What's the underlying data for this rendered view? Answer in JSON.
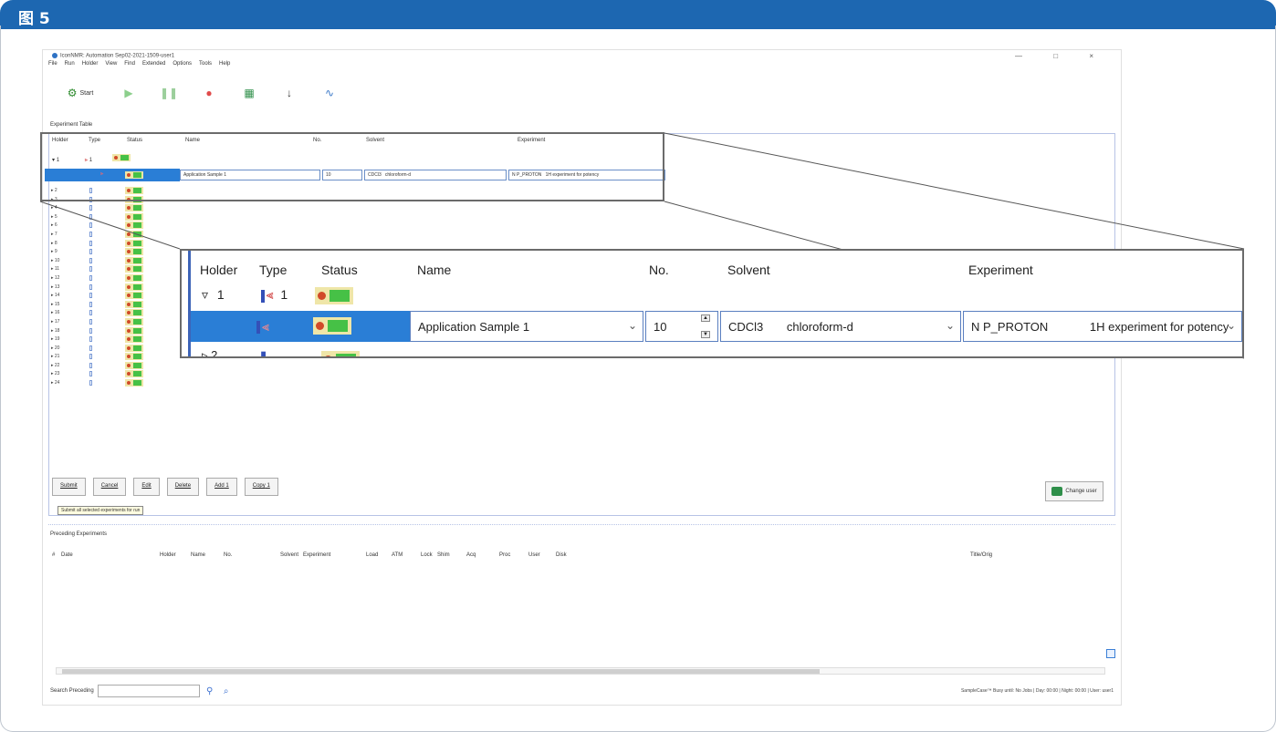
{
  "figure": {
    "label": "图 5"
  },
  "window": {
    "title": "IconNMR: Automation Sep02-2021-1509-user1",
    "controls": "— □ ×"
  },
  "menu": [
    "File",
    "Run",
    "Holder",
    "View",
    "Find",
    "Extended",
    "Options",
    "Tools",
    "Help"
  ],
  "toolbar": {
    "start_label": "Start"
  },
  "experiment_table": {
    "title": "Experiment Table",
    "columns": [
      "Holder",
      "Type",
      "Status",
      "Name",
      "No.",
      "Solvent",
      "Experiment"
    ],
    "holder1": {
      "holder": "1",
      "type_count": "1"
    },
    "selected": {
      "name": "Application Sample 1",
      "no": "10",
      "solvent_code": "CDCl3",
      "solvent_name": "chloroform-d",
      "experiment_code": "N P_PROTON",
      "experiment_desc": "1H experiment for potency"
    },
    "holders": [
      "2",
      "3",
      "4",
      "5",
      "6",
      "7",
      "8",
      "9",
      "10",
      "11",
      "12",
      "13",
      "14",
      "15",
      "16",
      "17",
      "18",
      "19",
      "20",
      "21",
      "22",
      "23",
      "24"
    ]
  },
  "buttons": {
    "submit": "Submit",
    "cancel": "Cancel",
    "edit": "Edit",
    "delete": "Delete",
    "add": "Add",
    "add_value": "1",
    "copy": "Copy",
    "copy_value": "1",
    "change_user": "Change user",
    "submit_tooltip": "Submit all selected experiments for run"
  },
  "preceding": {
    "title": "Preceding Experiments",
    "columns": [
      "#",
      "Date",
      "Holder",
      "Name",
      "No.",
      "Solvent",
      "Experiment",
      "Load",
      "ATM",
      "Lock",
      "Shim",
      "Acq",
      "Proc",
      "User",
      "Disk"
    ],
    "title_orig": "Title/Orig"
  },
  "search": {
    "label": "Search Preceding"
  },
  "statusbar": {
    "text": "SampleCase™  Busy until: No Jobs | Day: 00:00 | Night: 00:00 | User: user1"
  },
  "callout": {
    "row2_holder": "2"
  },
  "colors": {
    "header_blue": "#1d67b1",
    "selection_blue": "#2a7ed6",
    "status_green": "#46c146",
    "status_red": "#d14a28"
  }
}
